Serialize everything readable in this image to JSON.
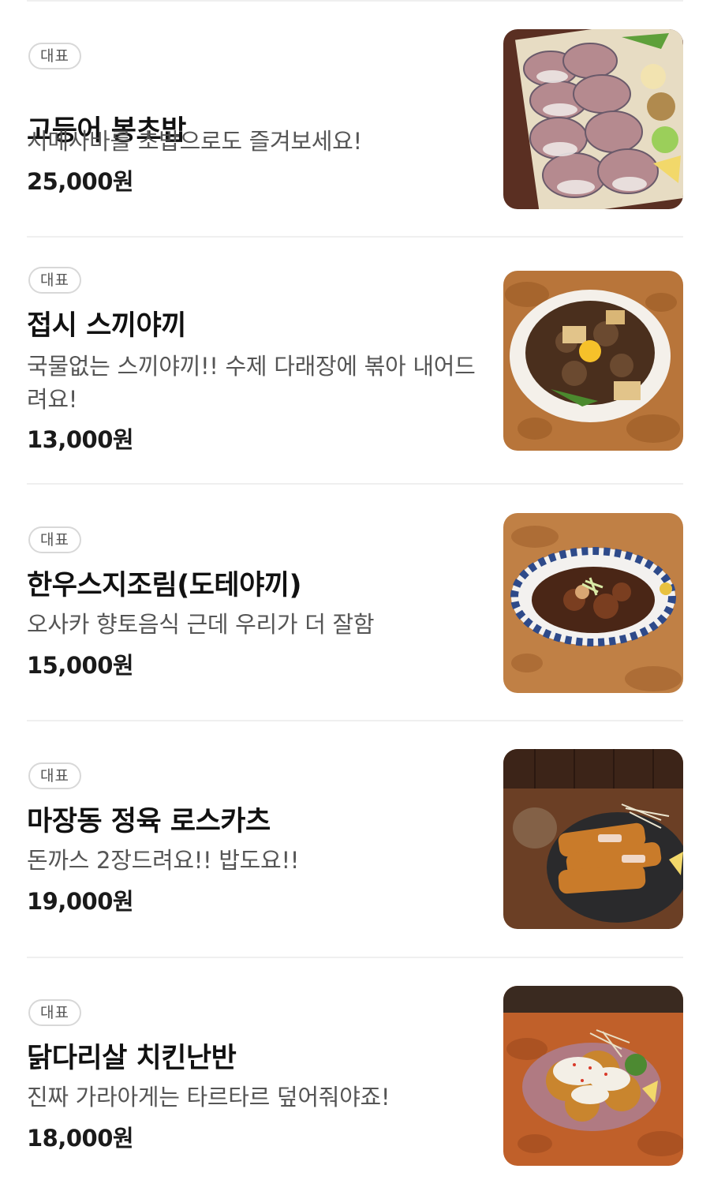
{
  "menu": {
    "items": [
      {
        "badge": "대표",
        "name": "고등어 봉초밥",
        "description": "시메사바를 초밥으로도 즐겨보세요!",
        "price": "25,000원",
        "image_icon": "mackerel-sushi-photo"
      },
      {
        "badge": "대표",
        "name": "접시 스끼야끼",
        "description": "국물없는 스끼야끼!! 수제 다래장에 볶아 내어드려요!",
        "price": "13,000원",
        "image_icon": "sukiyaki-plate-photo"
      },
      {
        "badge": "대표",
        "name": "한우스지조림(도테야끼)",
        "description": "오사카 향토음식 근데 우리가 더 잘함",
        "price": "15,000원",
        "image_icon": "beef-tendon-stew-photo"
      },
      {
        "badge": "대표",
        "name": "마장동 정육 로스카츠",
        "description": "돈까스 2장드려요!! 밥도요!!",
        "price": "19,000원",
        "image_icon": "pork-cutlet-photo"
      },
      {
        "badge": "대표",
        "name": "닭다리살 치킨난반",
        "description": "진짜 가라아게는 타르타르 덮어줘야죠!",
        "price": "18,000원",
        "image_icon": "chicken-nanban-photo"
      }
    ]
  },
  "colors": {
    "badge_border": "#d8d8d8",
    "divider": "#efefef",
    "description_text": "#555555",
    "title_text": "#111111"
  }
}
